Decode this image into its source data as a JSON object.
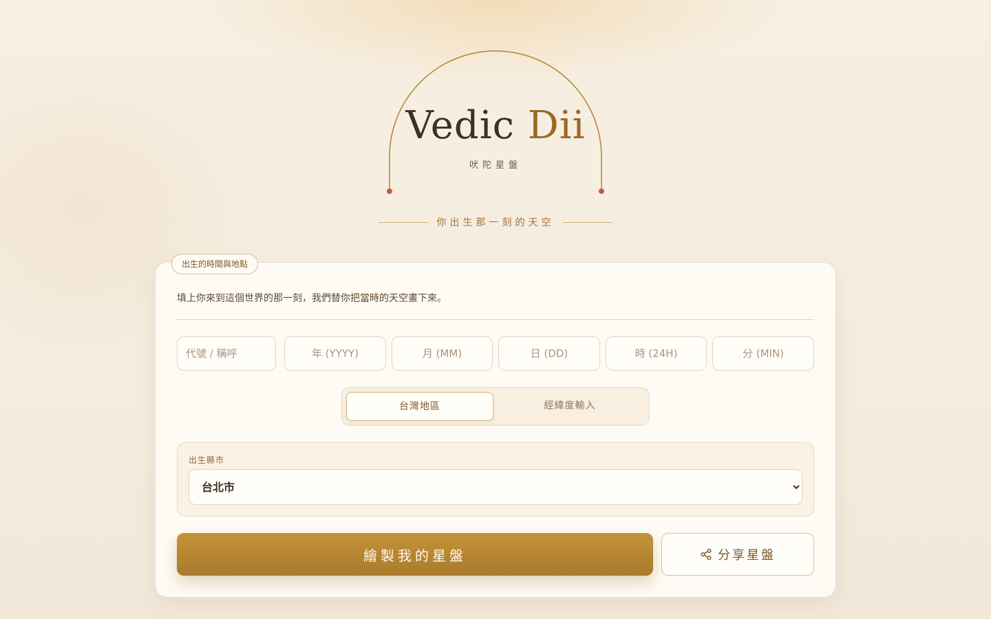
{
  "header": {
    "brand_main": "Vedic ",
    "brand_accent": "Dii",
    "subtitle": "吠陀星盤",
    "tagline": "你出生那一刻的天空"
  },
  "form": {
    "tag": "出生的時間與地點",
    "intro": "填上你來到這個世界的那一刻，我們替你把當時的天空畫下來。",
    "fields": {
      "nickname_placeholder": "代號 / 稱呼",
      "year_placeholder": "年 (YYYY)",
      "month_placeholder": "月 (MM)",
      "day_placeholder": "日 (DD)",
      "hour_placeholder": "時 (24H)",
      "minute_placeholder": "分 (MIN)"
    },
    "location_mode": {
      "taiwan_label": "台灣地區",
      "latlon_label": "經緯度輸入"
    },
    "city": {
      "label": "出生縣市",
      "selected": "台北市"
    },
    "actions": {
      "draw_label": "繪製我的星盤",
      "share_label": "分享星盤"
    }
  },
  "colors": {
    "accent": "#9a6a24",
    "primary_button": "#b8892f",
    "arch_line": "#b58a3c",
    "arch_dot": "#c0603a"
  },
  "icons": {
    "share": "share-icon"
  }
}
